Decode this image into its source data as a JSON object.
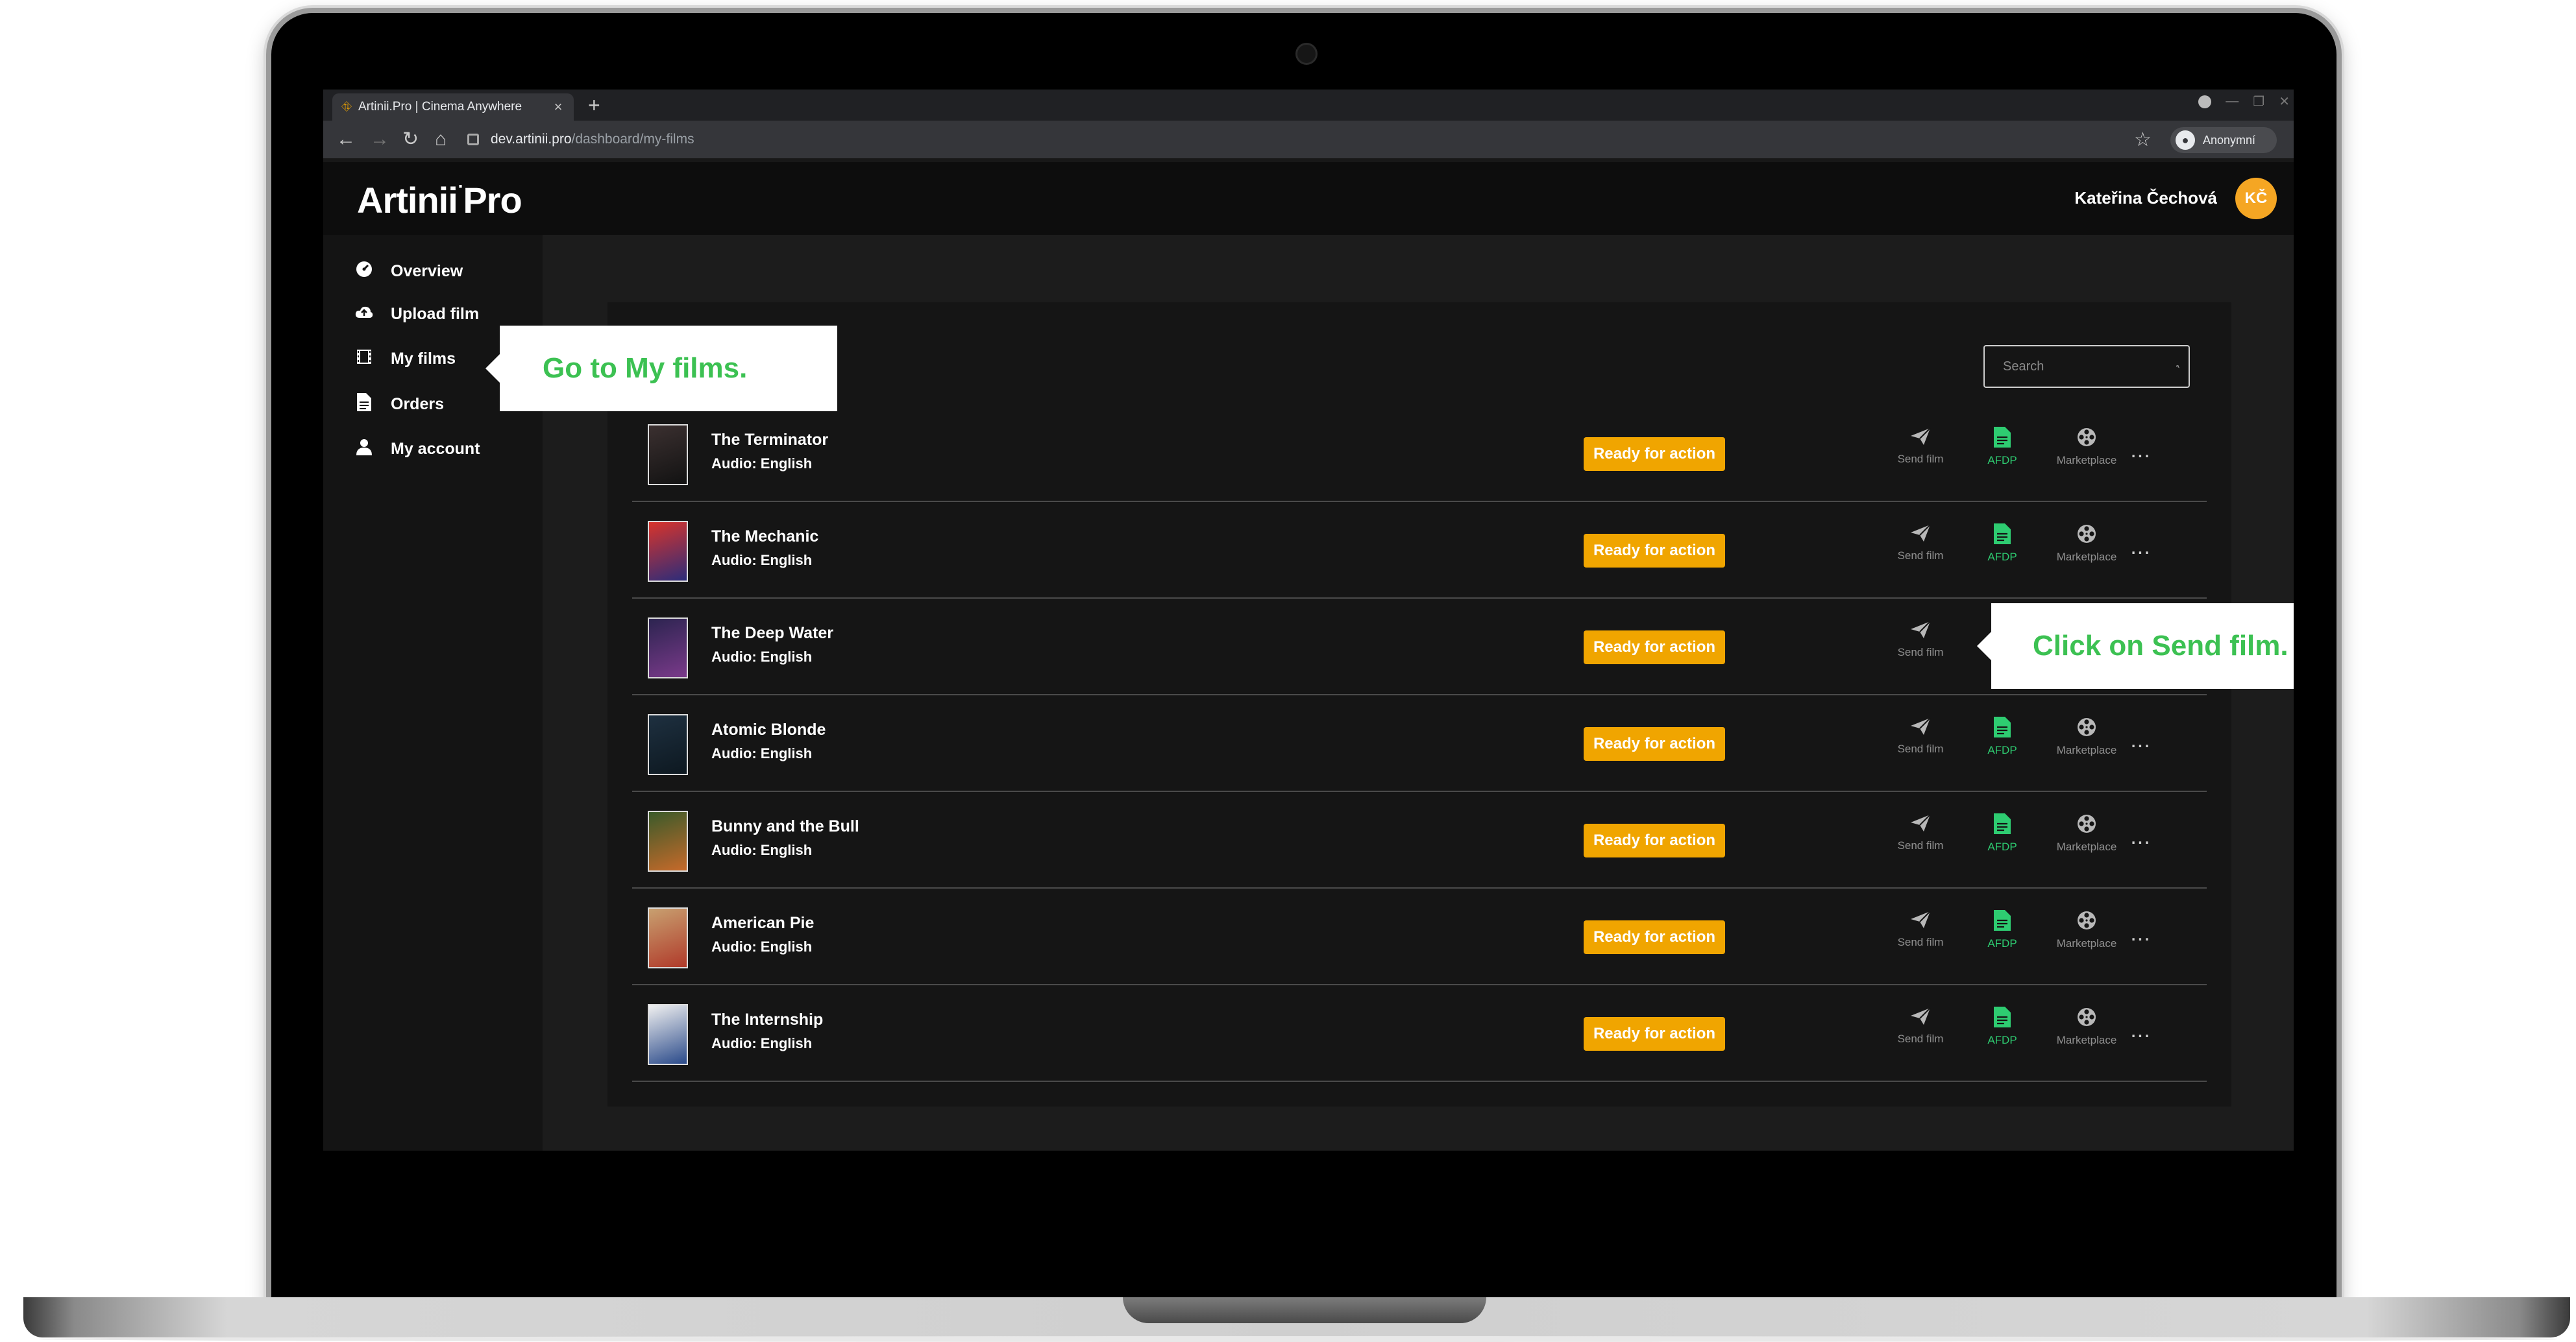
{
  "browser": {
    "tab_title": "Artinii.Pro | Cinema Anywhere",
    "tab_close": "×",
    "new_tab": "+",
    "url_host": "dev.artinii.pro",
    "url_path": "/dashboard/my-films",
    "profile_label": "Anonymní"
  },
  "app": {
    "logo_main": "Artinii",
    "logo_suffix": "Pro",
    "user_name": "Kateřina Čechová",
    "user_initials": "KČ"
  },
  "sidebar": {
    "items": [
      {
        "label": "Overview",
        "icon": "dashboard-icon"
      },
      {
        "label": "Upload film",
        "icon": "cloud-upload-icon"
      },
      {
        "label": "My films",
        "icon": "film-icon"
      },
      {
        "label": "Orders",
        "icon": "document-icon"
      },
      {
        "label": "My account",
        "icon": "user-icon"
      }
    ]
  },
  "search": {
    "placeholder": "Search"
  },
  "actions": {
    "send": "Send film",
    "afdp": "AFDP",
    "marketplace": "Marketplace",
    "more": "..."
  },
  "films": [
    {
      "title": "The Terminator",
      "audio": "Audio: English",
      "status": "Ready for action"
    },
    {
      "title": "The Mechanic",
      "audio": "Audio: English",
      "status": "Ready for action"
    },
    {
      "title": "The Deep Water",
      "audio": "Audio: English",
      "status": "Ready for action"
    },
    {
      "title": "Atomic Blonde",
      "audio": "Audio: English",
      "status": "Ready for action"
    },
    {
      "title": "Bunny and the Bull",
      "audio": "Audio: English",
      "status": "Ready for action"
    },
    {
      "title": "American Pie",
      "audio": "Audio: English",
      "status": "Ready for action"
    },
    {
      "title": "The Internship",
      "audio": "Audio: English",
      "status": "Ready for action"
    }
  ],
  "callouts": {
    "my_films": "Go to My films.",
    "send_film": "Click on Send film."
  },
  "colors": {
    "accent": "#f0a500",
    "callout_text": "#3cc152",
    "afdp": "#2ecc71",
    "avatar": "#f5a623"
  }
}
